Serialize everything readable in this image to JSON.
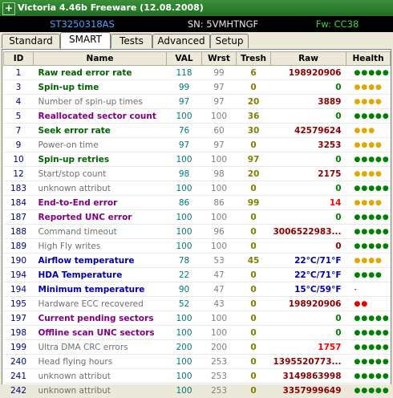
{
  "window": {
    "title": "Victoria 4.46b Freeware (12.08.2008)"
  },
  "drive": {
    "model": "ST3250318AS",
    "serial": "SN: 5VMHTNGF",
    "firmware": "Fw: CC38"
  },
  "tabs": [
    "Standard",
    "SMART",
    "Tests",
    "Advanced",
    "Setup"
  ],
  "active_tab": "SMART",
  "columns": [
    "ID",
    "Name",
    "VAL",
    "Wrst",
    "Tresh",
    "Raw",
    "Health"
  ],
  "rows": [
    {
      "id": "1",
      "name": "Raw read error rate",
      "val": "118",
      "wrst": "99",
      "tresh": "6",
      "raw": "198920906",
      "health": "●●●●●",
      "name_color": "green",
      "health_color": "green",
      "raw_color": ""
    },
    {
      "id": "3",
      "name": "Spin-up time",
      "val": "99",
      "wrst": "97",
      "tresh": "0",
      "raw": "0",
      "health": "●●●●",
      "name_color": "green",
      "health_color": "yellow",
      "raw_color": "green"
    },
    {
      "id": "4",
      "name": "Number of spin-up times",
      "val": "97",
      "wrst": "97",
      "tresh": "20",
      "raw": "3889",
      "health": "●●●●",
      "name_color": "gray",
      "health_color": "yellow",
      "raw_color": ""
    },
    {
      "id": "5",
      "name": "Reallocated sector count",
      "val": "100",
      "wrst": "100",
      "tresh": "36",
      "raw": "0",
      "health": "●●●●●",
      "name_color": "purple",
      "health_color": "green",
      "raw_color": "green"
    },
    {
      "id": "7",
      "name": "Seek error rate",
      "val": "76",
      "wrst": "60",
      "tresh": "30",
      "raw": "42579624",
      "health": "●●●",
      "name_color": "green",
      "health_color": "yellow",
      "raw_color": ""
    },
    {
      "id": "9",
      "name": "Power-on time",
      "val": "97",
      "wrst": "97",
      "tresh": "0",
      "raw": "3253",
      "health": "●●●●",
      "name_color": "gray",
      "health_color": "yellow",
      "raw_color": ""
    },
    {
      "id": "10",
      "name": "Spin-up retries",
      "val": "100",
      "wrst": "100",
      "tresh": "97",
      "raw": "0",
      "health": "●●●●●",
      "name_color": "green",
      "health_color": "green",
      "raw_color": "green"
    },
    {
      "id": "12",
      "name": "Start/stop count",
      "val": "98",
      "wrst": "98",
      "tresh": "20",
      "raw": "2175",
      "health": "●●●●",
      "name_color": "gray",
      "health_color": "yellow",
      "raw_color": ""
    },
    {
      "id": "183",
      "name": "unknown attribut",
      "val": "100",
      "wrst": "100",
      "tresh": "0",
      "raw": "0",
      "health": "●●●●●",
      "name_color": "gray",
      "health_color": "green",
      "raw_color": "green"
    },
    {
      "id": "184",
      "name": "End-to-End error",
      "val": "86",
      "wrst": "86",
      "tresh": "99",
      "raw": "14",
      "health": "●●●●",
      "name_color": "purple",
      "health_color": "yellow",
      "raw_color": "red"
    },
    {
      "id": "187",
      "name": "Reported UNC error",
      "val": "100",
      "wrst": "100",
      "tresh": "0",
      "raw": "0",
      "health": "●●●●●",
      "name_color": "purple",
      "health_color": "green",
      "raw_color": "green"
    },
    {
      "id": "188",
      "name": "Command timeout",
      "val": "100",
      "wrst": "96",
      "tresh": "0",
      "raw": "3006522983...",
      "health": "●●●●●",
      "name_color": "gray",
      "health_color": "green",
      "raw_color": ""
    },
    {
      "id": "189",
      "name": "High Fly writes",
      "val": "100",
      "wrst": "100",
      "tresh": "0",
      "raw": "0",
      "health": "●●●●●",
      "name_color": "gray",
      "health_color": "green",
      "raw_color": ""
    },
    {
      "id": "190",
      "name": "Airflow temperature",
      "val": "78",
      "wrst": "53",
      "tresh": "45",
      "raw": "22°C/71°F",
      "health": "●●●●",
      "name_color": "blue",
      "health_color": "yellow",
      "raw_color": "blue"
    },
    {
      "id": "194",
      "name": "HDA Temperature",
      "val": "22",
      "wrst": "47",
      "tresh": "0",
      "raw": "22°C/71°F",
      "health": "●●●●",
      "name_color": "blue",
      "health_color": "green",
      "raw_color": "blue"
    },
    {
      "id": "194",
      "name": "Minimum temperature",
      "val": "90",
      "wrst": "47",
      "tresh": "0",
      "raw": "15°C/59°F",
      "health": "-",
      "name_color": "blue",
      "health_color": "none",
      "raw_color": "blue"
    },
    {
      "id": "195",
      "name": "Hardware ECC recovered",
      "val": "52",
      "wrst": "43",
      "tresh": "0",
      "raw": "198920906",
      "health": "●●",
      "name_color": "gray",
      "health_color": "red",
      "raw_color": ""
    },
    {
      "id": "197",
      "name": "Current pending sectors",
      "val": "100",
      "wrst": "100",
      "tresh": "0",
      "raw": "0",
      "health": "●●●●●",
      "name_color": "purple",
      "health_color": "green",
      "raw_color": "green"
    },
    {
      "id": "198",
      "name": "Offline scan UNC sectors",
      "val": "100",
      "wrst": "100",
      "tresh": "0",
      "raw": "0",
      "health": "●●●●●",
      "name_color": "purple",
      "health_color": "green",
      "raw_color": "green"
    },
    {
      "id": "199",
      "name": "Ultra DMA CRC errors",
      "val": "200",
      "wrst": "200",
      "tresh": "0",
      "raw": "1757",
      "health": "●●●●●",
      "name_color": "gray",
      "health_color": "green",
      "raw_color": "red"
    },
    {
      "id": "240",
      "name": "Head flying hours",
      "val": "100",
      "wrst": "253",
      "tresh": "0",
      "raw": "1395520773...",
      "health": "●●●●●",
      "name_color": "gray",
      "health_color": "green",
      "raw_color": ""
    },
    {
      "id": "241",
      "name": "unknown attribut",
      "val": "100",
      "wrst": "253",
      "tresh": "0",
      "raw": "3149863998",
      "health": "●●●●●",
      "name_color": "gray",
      "health_color": "green",
      "raw_color": ""
    },
    {
      "id": "242",
      "name": "unknown attribut",
      "val": "100",
      "wrst": "253",
      "tresh": "0",
      "raw": "3357999649",
      "health": "●●●●●",
      "name_color": "gray",
      "health_color": "green",
      "raw_color": ""
    }
  ]
}
